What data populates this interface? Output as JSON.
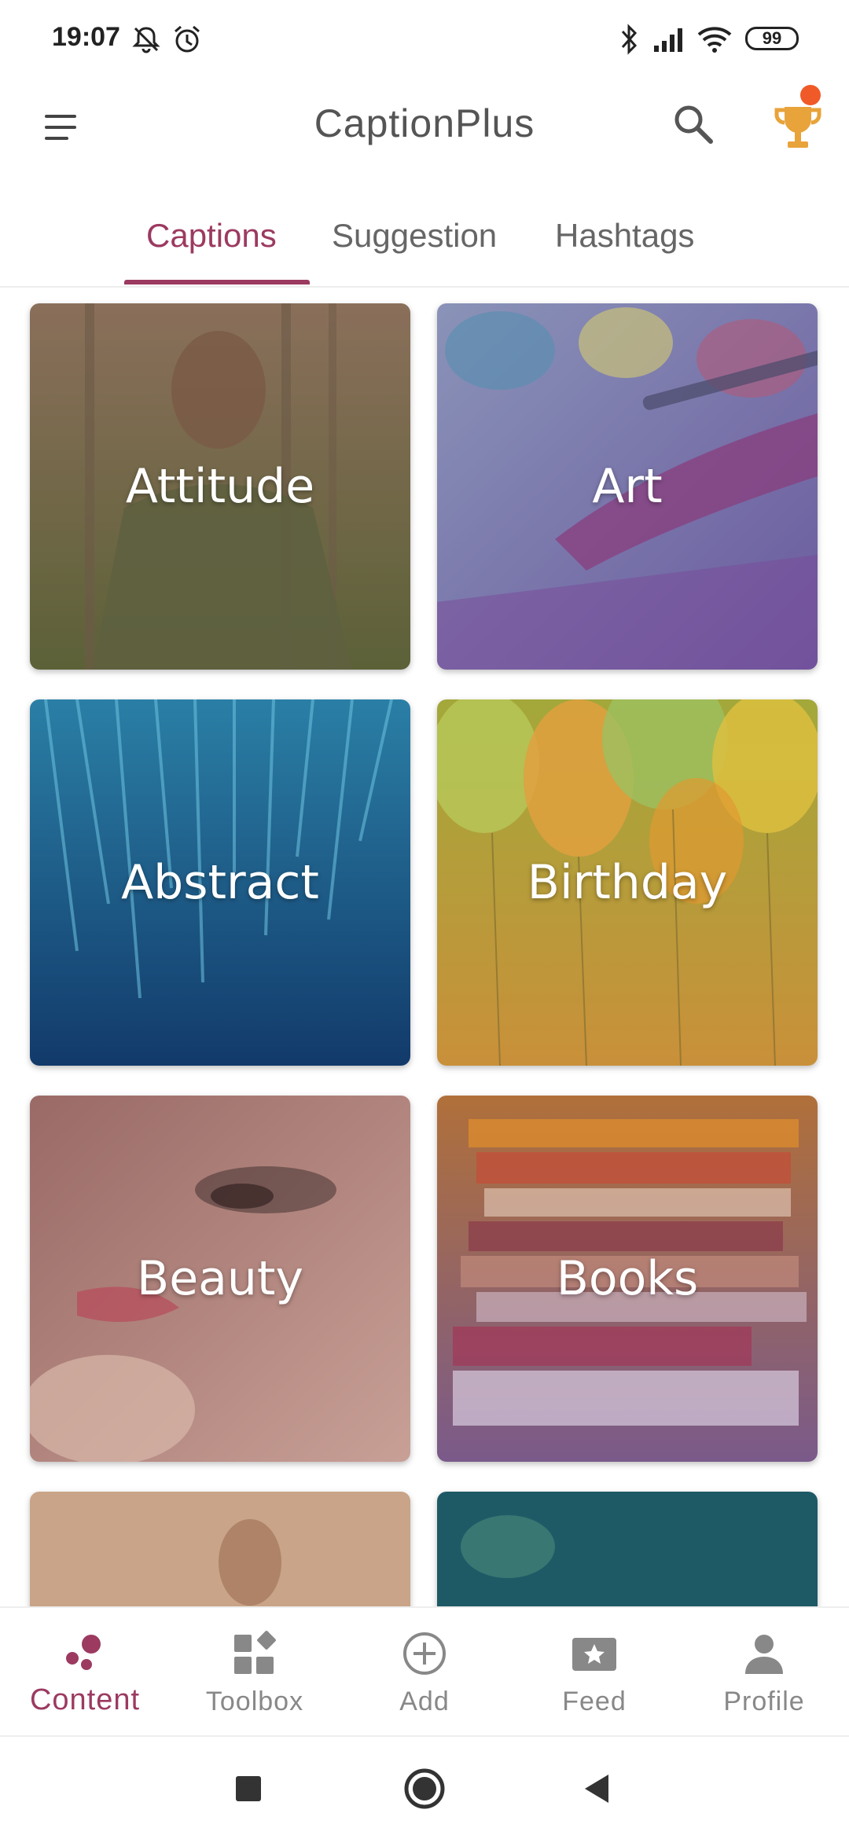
{
  "status_bar": {
    "time": "19:07",
    "battery": "99",
    "icons": [
      "mute-icon",
      "alarm-icon",
      "bluetooth-icon",
      "signal-icon",
      "wifi-icon",
      "battery-icon"
    ]
  },
  "app_bar": {
    "title": "CaptionPlus",
    "icons": [
      "menu-icon",
      "search-icon",
      "trophy-icon"
    ],
    "notification_dot_color": "#f05a28"
  },
  "tabs": [
    {
      "label": "Captions",
      "active": true
    },
    {
      "label": "Suggestion",
      "active": false
    },
    {
      "label": "Hashtags",
      "active": false
    }
  ],
  "accent_color": "#9c3a60",
  "categories": [
    {
      "label": "Attitude"
    },
    {
      "label": "Art"
    },
    {
      "label": "Abstract"
    },
    {
      "label": "Birthday"
    },
    {
      "label": "Beauty"
    },
    {
      "label": "Books"
    },
    {
      "label": ""
    },
    {
      "label": ""
    }
  ],
  "bottom_nav": [
    {
      "label": "Content",
      "icon": "content-icon",
      "active": true
    },
    {
      "label": "Toolbox",
      "icon": "toolbox-icon",
      "active": false
    },
    {
      "label": "Add",
      "icon": "add-icon",
      "active": false
    },
    {
      "label": "Feed",
      "icon": "feed-icon",
      "active": false
    },
    {
      "label": "Profile",
      "icon": "profile-icon",
      "active": false
    }
  ],
  "system_nav": [
    "recents-icon",
    "home-icon",
    "back-icon"
  ]
}
